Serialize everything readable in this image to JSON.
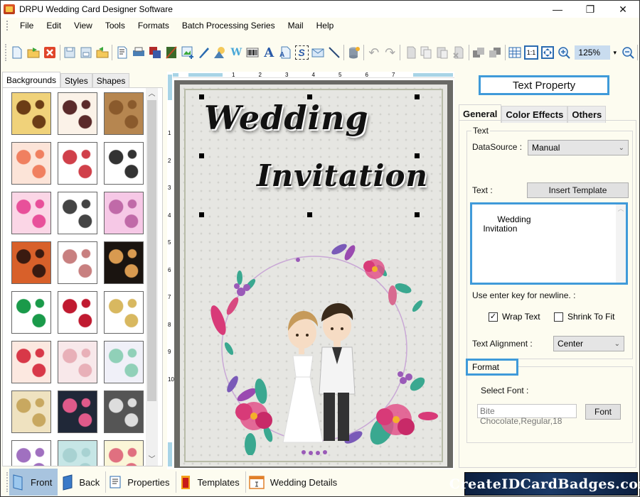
{
  "window": {
    "title": "DRPU Wedding Card Designer Software",
    "minimize": "—",
    "restore": "❐",
    "close": "✕"
  },
  "menu": [
    "File",
    "Edit",
    "View",
    "Tools",
    "Formats",
    "Batch Processing Series",
    "Mail",
    "Help"
  ],
  "toolbar": {
    "icons": [
      "new-icon",
      "open-icon",
      "close-icon",
      "save-icon",
      "save-as-icon",
      "export-icon",
      "print-preview-icon",
      "print-icon",
      "layers-icon",
      "image-edit-icon",
      "insert-image-icon",
      "pen-icon",
      "shapes-icon",
      "wordart-icon",
      "barcode-icon",
      "text-icon",
      "text-file-icon",
      "signature-icon",
      "mail-icon",
      "line-icon",
      "database-icon",
      "undo-icon",
      "redo-icon",
      "cut-icon",
      "copy-icon",
      "paste-icon",
      "delete-icon",
      "bring-forward-icon",
      "send-backward-icon",
      "grid-icon",
      "actual-size-icon",
      "fit-window-icon",
      "zoom-in-icon"
    ],
    "zoom_value": "125%",
    "zoom_out": "zoom-out-icon"
  },
  "left_panel": {
    "tabs": [
      "Backgrounds",
      "Styles",
      "Shapes"
    ],
    "active_tab": "Backgrounds",
    "thumbnails": [
      {
        "name": "golden-butterfly-pattern",
        "colors": [
          "#f0d27a",
          "#6b3d16"
        ]
      },
      {
        "name": "paisley-lace",
        "colors": [
          "#fbf2e8",
          "#5a2a2a"
        ]
      },
      {
        "name": "brown-circle-tiles",
        "colors": [
          "#b68650",
          "#8a5a2c"
        ]
      },
      {
        "name": "peach-flowers",
        "colors": [
          "#fce4d8",
          "#f08060"
        ]
      },
      {
        "name": "hearts-grid",
        "colors": [
          "#ffffff",
          "#d0404a"
        ]
      },
      {
        "name": "wedding-palanquin",
        "colors": [
          "#ffffff",
          "#333333"
        ]
      },
      {
        "name": "pink-hearts",
        "colors": [
          "#fbd6e6",
          "#e8509a"
        ]
      },
      {
        "name": "wedding-couples",
        "colors": [
          "#ffffff",
          "#444444"
        ]
      },
      {
        "name": "pink-swirls",
        "colors": [
          "#f6c8e6",
          "#c06aa8"
        ]
      },
      {
        "name": "ganesha-orange",
        "colors": [
          "#d8602a",
          "#3a1a10"
        ]
      },
      {
        "name": "pink-elephant",
        "colors": [
          "#ffffff",
          "#c88080"
        ]
      },
      {
        "name": "black-floral",
        "colors": [
          "#1a1410",
          "#d89a50"
        ]
      },
      {
        "name": "ganesha-leaf",
        "colors": [
          "#ffffff",
          "#1a9a4a"
        ]
      },
      {
        "name": "rose-petals",
        "colors": [
          "#ffffff",
          "#c01a30"
        ]
      },
      {
        "name": "crescent-star",
        "colors": [
          "#ffffff",
          "#d8b860"
        ]
      },
      {
        "name": "red-hearts-pattern",
        "colors": [
          "#fce8e0",
          "#d83848"
        ]
      },
      {
        "name": "pink-lace",
        "colors": [
          "#f8e8ea",
          "#e8b0b8"
        ]
      },
      {
        "name": "mint-mandala",
        "colors": [
          "#f0f0f8",
          "#90d0b8"
        ]
      },
      {
        "name": "cream-rose-rings",
        "colors": [
          "#efe2c0",
          "#c8a860"
        ]
      },
      {
        "name": "navy-floral-border",
        "colors": [
          "#202838",
          "#e05a8a"
        ]
      },
      {
        "name": "grey-lace",
        "colors": [
          "#555555",
          "#dddddd"
        ]
      },
      {
        "name": "purple-flowers",
        "colors": [
          "#ffffff",
          "#a070c0"
        ]
      },
      {
        "name": "aqua-hearts",
        "colors": [
          "#c6e6e6",
          "#a8d2d2"
        ]
      },
      {
        "name": "striped-hearts",
        "colors": [
          "#fbf6d8",
          "#e07080"
        ]
      }
    ]
  },
  "rulers": {
    "horizontal": [
      "1",
      "2",
      "3",
      "4",
      "5",
      "6",
      "7"
    ],
    "vertical": [
      "1",
      "2",
      "3",
      "4",
      "5",
      "6",
      "7",
      "8",
      "9",
      "10"
    ]
  },
  "card": {
    "line1": "Wedding",
    "line2": "Invitation",
    "background_color": "#e6e6e2",
    "illustration": "bride-and-groom-floral-wreath"
  },
  "right_panel": {
    "header": "Text Property",
    "tabs": [
      "General",
      "Color Effects",
      "Others"
    ],
    "active_tab": "General",
    "text_group": {
      "title": "Text",
      "datasource_label": "DataSource :",
      "datasource_value": "Manual",
      "text_label": "Text :",
      "insert_template": "Insert Template",
      "text_value": "Wedding\n    Invitation",
      "hint": "Use enter key for newline. :",
      "wrap_text": {
        "label": "Wrap Text",
        "checked": true
      },
      "shrink_to_fit": {
        "label": "Shrink To Fit",
        "checked": false
      },
      "alignment_label": "Text Alignment :",
      "alignment_value": "Center"
    },
    "format_group": {
      "title": "Format",
      "select_font_label": "Select Font :",
      "font_value": "Bite Chocolate,Regular,18",
      "font_button": "Font"
    }
  },
  "bottom_bar": {
    "items": [
      {
        "label": "Front",
        "icon": "front-page-icon",
        "active": true
      },
      {
        "label": "Back",
        "icon": "back-page-icon",
        "active": false
      },
      {
        "label": "Properties",
        "icon": "properties-icon",
        "active": false
      },
      {
        "label": "Templates",
        "icon": "templates-icon",
        "active": false
      },
      {
        "label": "Wedding Details",
        "icon": "wedding-details-icon",
        "active": false
      }
    ]
  },
  "brand": "CreateIDCardBadges.com",
  "accent_color": "#3f9ad9"
}
